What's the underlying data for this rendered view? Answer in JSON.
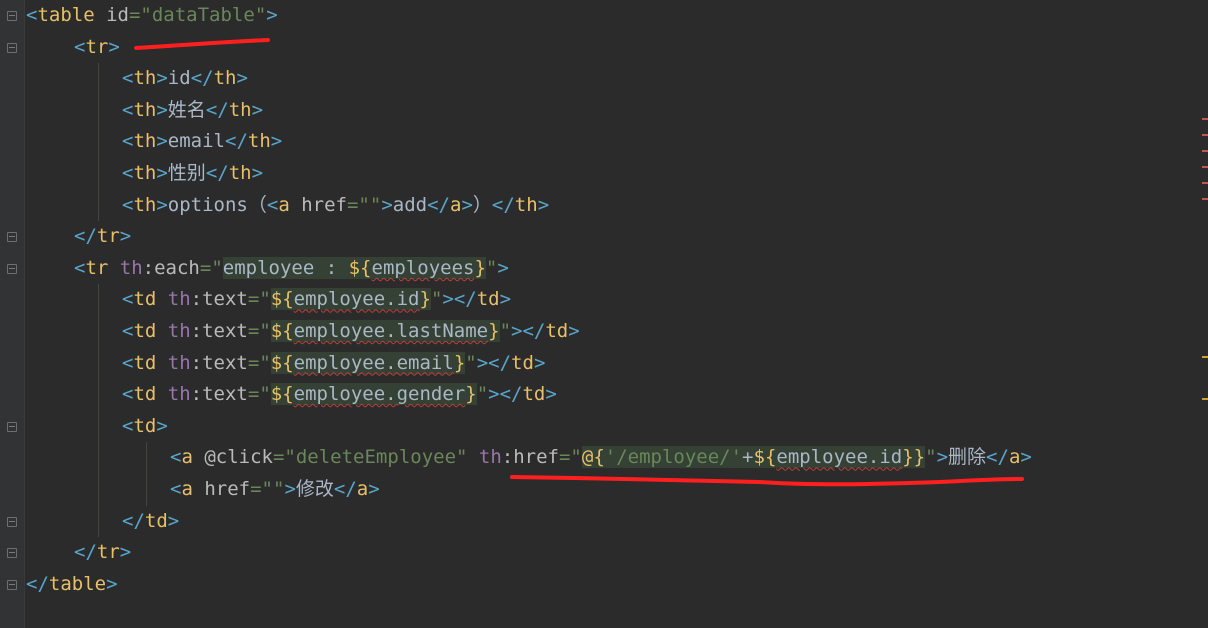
{
  "editor": {
    "lines": [
      {
        "indent": 0,
        "tokens": [
          {
            "t": "<",
            "c": "t-br"
          },
          {
            "t": "table",
            "c": "t-tag"
          },
          {
            "t": " id",
            "c": "t-attr"
          },
          {
            "t": "=\"dataTable\"",
            "c": "t-str"
          },
          {
            "t": ">",
            "c": "t-br"
          }
        ]
      },
      {
        "indent": 1,
        "tokens": [
          {
            "t": "<",
            "c": "t-br"
          },
          {
            "t": "tr",
            "c": "t-tag"
          },
          {
            "t": ">",
            "c": "t-br"
          }
        ]
      },
      {
        "indent": 2,
        "tokens": [
          {
            "t": "<",
            "c": "t-br"
          },
          {
            "t": "th",
            "c": "t-tag"
          },
          {
            "t": ">",
            "c": "t-br"
          },
          {
            "t": "id",
            "c": "t-text"
          },
          {
            "t": "</",
            "c": "t-br"
          },
          {
            "t": "th",
            "c": "t-tag"
          },
          {
            "t": ">",
            "c": "t-br"
          }
        ]
      },
      {
        "indent": 2,
        "tokens": [
          {
            "t": "<",
            "c": "t-br"
          },
          {
            "t": "th",
            "c": "t-tag"
          },
          {
            "t": ">",
            "c": "t-br"
          },
          {
            "t": "姓名",
            "c": "t-text"
          },
          {
            "t": "</",
            "c": "t-br"
          },
          {
            "t": "th",
            "c": "t-tag"
          },
          {
            "t": ">",
            "c": "t-br"
          }
        ]
      },
      {
        "indent": 2,
        "tokens": [
          {
            "t": "<",
            "c": "t-br"
          },
          {
            "t": "th",
            "c": "t-tag"
          },
          {
            "t": ">",
            "c": "t-br"
          },
          {
            "t": "email",
            "c": "t-text"
          },
          {
            "t": "</",
            "c": "t-br"
          },
          {
            "t": "th",
            "c": "t-tag"
          },
          {
            "t": ">",
            "c": "t-br"
          }
        ]
      },
      {
        "indent": 2,
        "tokens": [
          {
            "t": "<",
            "c": "t-br"
          },
          {
            "t": "th",
            "c": "t-tag"
          },
          {
            "t": ">",
            "c": "t-br"
          },
          {
            "t": "性别",
            "c": "t-text"
          },
          {
            "t": "</",
            "c": "t-br"
          },
          {
            "t": "th",
            "c": "t-tag"
          },
          {
            "t": ">",
            "c": "t-br"
          }
        ]
      },
      {
        "indent": 2,
        "tokens": [
          {
            "t": "<",
            "c": "t-br"
          },
          {
            "t": "th",
            "c": "t-tag"
          },
          {
            "t": ">",
            "c": "t-br"
          },
          {
            "t": "options（",
            "c": "t-text"
          },
          {
            "t": "<",
            "c": "t-br"
          },
          {
            "t": "a",
            "c": "t-tag"
          },
          {
            "t": " href",
            "c": "t-attr"
          },
          {
            "t": "=\"\"",
            "c": "t-str"
          },
          {
            "t": ">",
            "c": "t-br"
          },
          {
            "t": "add",
            "c": "t-text"
          },
          {
            "t": "</",
            "c": "t-br"
          },
          {
            "t": "a",
            "c": "t-tag"
          },
          {
            "t": ">",
            "c": "t-br"
          },
          {
            "t": "）",
            "c": "t-text"
          },
          {
            "t": "</",
            "c": "t-br"
          },
          {
            "t": "th",
            "c": "t-tag"
          },
          {
            "t": ">",
            "c": "t-br"
          }
        ]
      },
      {
        "indent": 1,
        "tokens": [
          {
            "t": "</",
            "c": "t-br"
          },
          {
            "t": "tr",
            "c": "t-tag"
          },
          {
            "t": ">",
            "c": "t-br"
          }
        ]
      },
      {
        "indent": 1,
        "tokens": [
          {
            "t": "<",
            "c": "t-br"
          },
          {
            "t": "tr",
            "c": "t-tag"
          },
          {
            "t": " th",
            "c": "t-ns"
          },
          {
            "t": ":each",
            "c": "t-attr"
          },
          {
            "t": "=\"",
            "c": "t-str"
          },
          {
            "t": "employee : ",
            "c": "t-expr"
          },
          {
            "t": "${",
            "c": "t-expr t-dlr"
          },
          {
            "t": "employees",
            "c": "t-expr t-ref"
          },
          {
            "t": "}",
            "c": "t-expr t-dlr"
          },
          {
            "t": "\"",
            "c": "t-str"
          },
          {
            "t": ">",
            "c": "t-br"
          }
        ]
      },
      {
        "indent": 2,
        "tokens": [
          {
            "t": "<",
            "c": "t-br"
          },
          {
            "t": "td",
            "c": "t-tag"
          },
          {
            "t": " th",
            "c": "t-ns"
          },
          {
            "t": ":text",
            "c": "t-attr"
          },
          {
            "t": "=\"",
            "c": "t-str"
          },
          {
            "t": "${",
            "c": "t-expr t-dlr"
          },
          {
            "t": "employee.id",
            "c": "t-expr t-ref"
          },
          {
            "t": "}",
            "c": "t-expr t-dlr"
          },
          {
            "t": "\"",
            "c": "t-str"
          },
          {
            "t": "></",
            "c": "t-br"
          },
          {
            "t": "td",
            "c": "t-tag"
          },
          {
            "t": ">",
            "c": "t-br"
          }
        ]
      },
      {
        "indent": 2,
        "tokens": [
          {
            "t": "<",
            "c": "t-br"
          },
          {
            "t": "td",
            "c": "t-tag"
          },
          {
            "t": " th",
            "c": "t-ns"
          },
          {
            "t": ":text",
            "c": "t-attr"
          },
          {
            "t": "=\"",
            "c": "t-str"
          },
          {
            "t": "${",
            "c": "t-expr t-dlr"
          },
          {
            "t": "employee.lastName",
            "c": "t-expr t-ref"
          },
          {
            "t": "}",
            "c": "t-expr t-dlr"
          },
          {
            "t": "\"",
            "c": "t-str"
          },
          {
            "t": "></",
            "c": "t-br"
          },
          {
            "t": "td",
            "c": "t-tag"
          },
          {
            "t": ">",
            "c": "t-br"
          }
        ]
      },
      {
        "indent": 2,
        "tokens": [
          {
            "t": "<",
            "c": "t-br"
          },
          {
            "t": "td",
            "c": "t-tag"
          },
          {
            "t": " th",
            "c": "t-ns"
          },
          {
            "t": ":text",
            "c": "t-attr"
          },
          {
            "t": "=\"",
            "c": "t-str"
          },
          {
            "t": "${",
            "c": "t-expr t-dlr"
          },
          {
            "t": "employee.email",
            "c": "t-expr t-ref"
          },
          {
            "t": "}",
            "c": "t-expr t-dlr"
          },
          {
            "t": "\"",
            "c": "t-str"
          },
          {
            "t": "></",
            "c": "t-br"
          },
          {
            "t": "td",
            "c": "t-tag"
          },
          {
            "t": ">",
            "c": "t-br"
          }
        ]
      },
      {
        "indent": 2,
        "tokens": [
          {
            "t": "<",
            "c": "t-br"
          },
          {
            "t": "td",
            "c": "t-tag"
          },
          {
            "t": " th",
            "c": "t-ns"
          },
          {
            "t": ":text",
            "c": "t-attr"
          },
          {
            "t": "=\"",
            "c": "t-str"
          },
          {
            "t": "${",
            "c": "t-expr t-dlr"
          },
          {
            "t": "employee.gender",
            "c": "t-expr t-ref"
          },
          {
            "t": "}",
            "c": "t-expr t-dlr"
          },
          {
            "t": "\"",
            "c": "t-str"
          },
          {
            "t": "></",
            "c": "t-br"
          },
          {
            "t": "td",
            "c": "t-tag"
          },
          {
            "t": ">",
            "c": "t-br"
          }
        ]
      },
      {
        "indent": 2,
        "tokens": [
          {
            "t": "<",
            "c": "t-br"
          },
          {
            "t": "td",
            "c": "t-tag"
          },
          {
            "t": ">",
            "c": "t-br"
          }
        ]
      },
      {
        "indent": 3,
        "tokens": [
          {
            "t": "<",
            "c": "t-br"
          },
          {
            "t": "a",
            "c": "t-tag"
          },
          {
            "t": " @click",
            "c": "t-attr"
          },
          {
            "t": "=\"deleteEmployee\"",
            "c": "t-str"
          },
          {
            "t": " th",
            "c": "t-ns"
          },
          {
            "t": ":href",
            "c": "t-attr"
          },
          {
            "t": "=\"",
            "c": "t-str"
          },
          {
            "t": "@{",
            "c": "t-expr t-dlr"
          },
          {
            "t": "'/employee/'",
            "c": "t-expr t-url"
          },
          {
            "t": "+",
            "c": "t-expr t-text"
          },
          {
            "t": "${",
            "c": "t-expr t-dlr"
          },
          {
            "t": "employee.id",
            "c": "t-expr t-ref"
          },
          {
            "t": "}}",
            "c": "t-expr t-dlr"
          },
          {
            "t": "\"",
            "c": "t-str"
          },
          {
            "t": ">",
            "c": "t-br"
          },
          {
            "t": "删除",
            "c": "t-text"
          },
          {
            "t": "</",
            "c": "t-br"
          },
          {
            "t": "a",
            "c": "t-tag"
          },
          {
            "t": ">",
            "c": "t-br"
          }
        ]
      },
      {
        "indent": 3,
        "tokens": [
          {
            "t": "<",
            "c": "t-br"
          },
          {
            "t": "a",
            "c": "t-tag"
          },
          {
            "t": " href",
            "c": "t-attr"
          },
          {
            "t": "=\"\"",
            "c": "t-str"
          },
          {
            "t": ">",
            "c": "t-br"
          },
          {
            "t": "修改",
            "c": "t-text"
          },
          {
            "t": "</",
            "c": "t-br"
          },
          {
            "t": "a",
            "c": "t-tag"
          },
          {
            "t": ">",
            "c": "t-br"
          }
        ]
      },
      {
        "indent": 2,
        "tokens": [
          {
            "t": "</",
            "c": "t-br"
          },
          {
            "t": "td",
            "c": "t-tag"
          },
          {
            "t": ">",
            "c": "t-br"
          }
        ]
      },
      {
        "indent": 1,
        "tokens": [
          {
            "t": "</",
            "c": "t-br"
          },
          {
            "t": "tr",
            "c": "t-tag"
          },
          {
            "t": ">",
            "c": "t-br"
          }
        ]
      },
      {
        "indent": 0,
        "tokens": [
          {
            "t": "</",
            "c": "t-br"
          },
          {
            "t": "table",
            "c": "t-tag"
          },
          {
            "t": ">",
            "c": "t-br"
          }
        ]
      }
    ]
  },
  "colors": {
    "background": "#2b2b2b",
    "tag": "#e8bf6a",
    "bracket": "#59a6cb",
    "string": "#6a8759",
    "namespace": "#9876aa",
    "annotation_red": "#ff1f1f",
    "marker_orange": "#d0a030"
  }
}
